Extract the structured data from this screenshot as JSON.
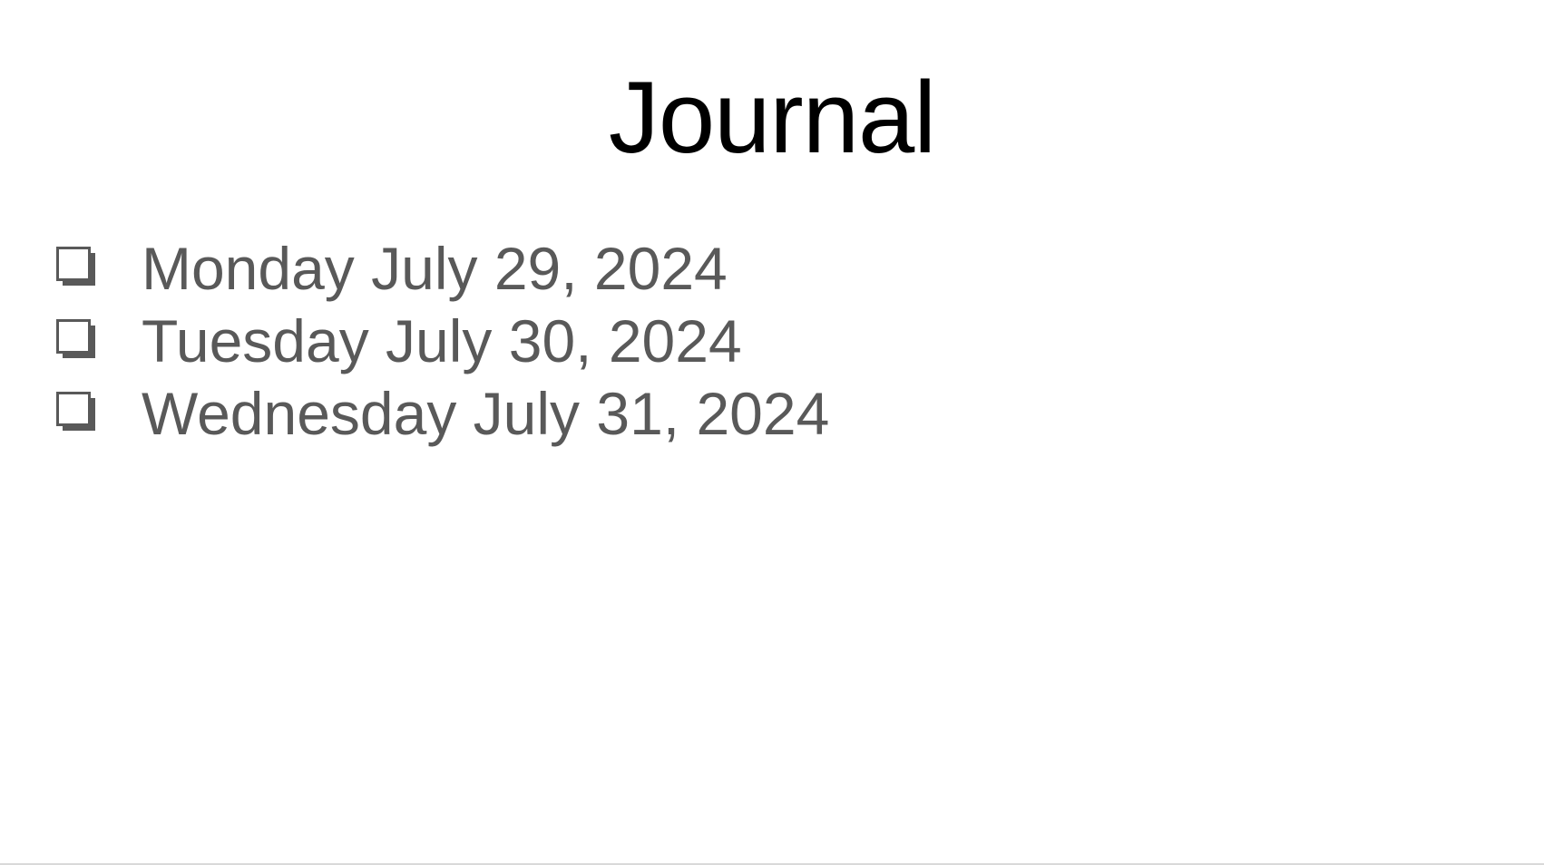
{
  "slide": {
    "title": "Journal",
    "items": [
      {
        "label": "Monday July 29, 2024",
        "icon": "checkbox-icon"
      },
      {
        "label": "Tuesday July 30, 2024",
        "icon": "checkbox-icon"
      },
      {
        "label": "Wednesday July 31, 2024",
        "icon": "checkbox-icon"
      }
    ]
  },
  "colors": {
    "title": "#000000",
    "body_text": "#595959",
    "background": "#ffffff"
  }
}
